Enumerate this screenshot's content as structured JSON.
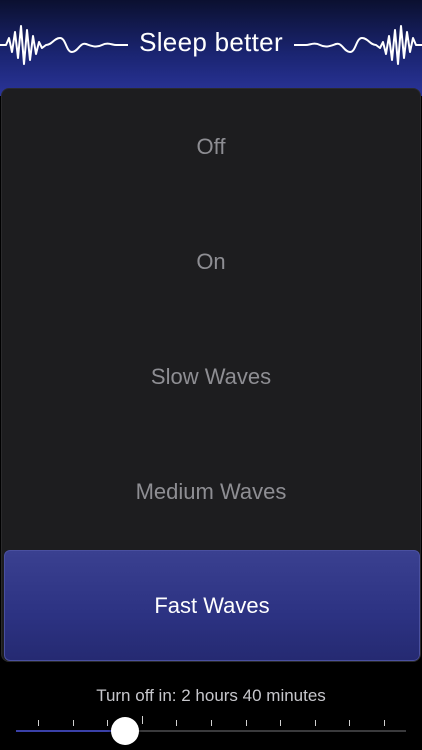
{
  "header": {
    "title": "Sleep better",
    "left_icon": "sound-wave-icon",
    "right_icon": "sound-wave-icon"
  },
  "options": [
    {
      "label": "Off",
      "selected": false
    },
    {
      "label": "On",
      "selected": false
    },
    {
      "label": "Slow Waves",
      "selected": false
    },
    {
      "label": "Medium Waves",
      "selected": false
    },
    {
      "label": "Fast Waves",
      "selected": true
    }
  ],
  "timer": {
    "label": "Turn off in: 2 hours 40 minutes",
    "slider_fraction": 0.28,
    "tick_count": 11
  },
  "colors": {
    "header_accent": "#2a3499",
    "selected_bg": "#2c3282",
    "panel_bg": "#1d1d1f"
  }
}
